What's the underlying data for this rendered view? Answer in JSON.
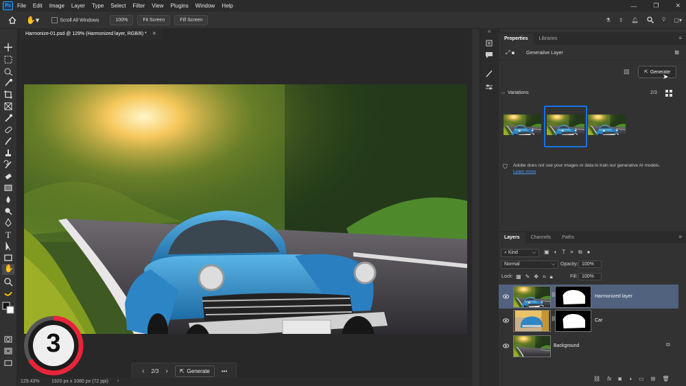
{
  "menubar": {
    "logo": "Ps",
    "items": [
      "File",
      "Edit",
      "Image",
      "Layer",
      "Type",
      "Select",
      "Filter",
      "View",
      "Plugins",
      "Window",
      "Help"
    ]
  },
  "options": {
    "scroll_all_windows": "Scroll All Windows",
    "zoom": "100%",
    "fit_screen": "Fit Screen",
    "fill_screen": "Fill Screen"
  },
  "document": {
    "tab_title": "Harmonize-01.psd @ 129% (Harmonized layer, RGB/8) *",
    "zoom_status": "129.43%",
    "size_status": "1920 px x 1080 px (72 ppi)"
  },
  "taskbar": {
    "counter": "2/3",
    "generate_label": "Generate"
  },
  "badge": {
    "number": "3"
  },
  "properties": {
    "tabs": [
      "Properties",
      "Libraries"
    ],
    "layer_type": "Generative Layer",
    "generate_label": "Generate",
    "variations_label": "Variations",
    "variations_counter": "2/3",
    "disclaimer": "Adobe does not use your images or data to train our generative AI models.",
    "learn_more": "Learn more"
  },
  "layers_panel": {
    "tabs": [
      "Layers",
      "Channels",
      "Paths"
    ],
    "filter_kind": "Kind",
    "blend_mode": "Normal",
    "opacity_label": "Opacity:",
    "opacity_value": "100%",
    "lock_label": "Lock:",
    "fill_label": "Fill:",
    "fill_value": "100%",
    "layers": [
      {
        "name": "Harmonized layer",
        "selected": true
      },
      {
        "name": "Car",
        "selected": false
      },
      {
        "name": "Background",
        "selected": false
      }
    ]
  },
  "colors": {
    "accent_blue": "#1473e6",
    "selected_layer": "#50627e",
    "badge_red": "#e8243a"
  }
}
